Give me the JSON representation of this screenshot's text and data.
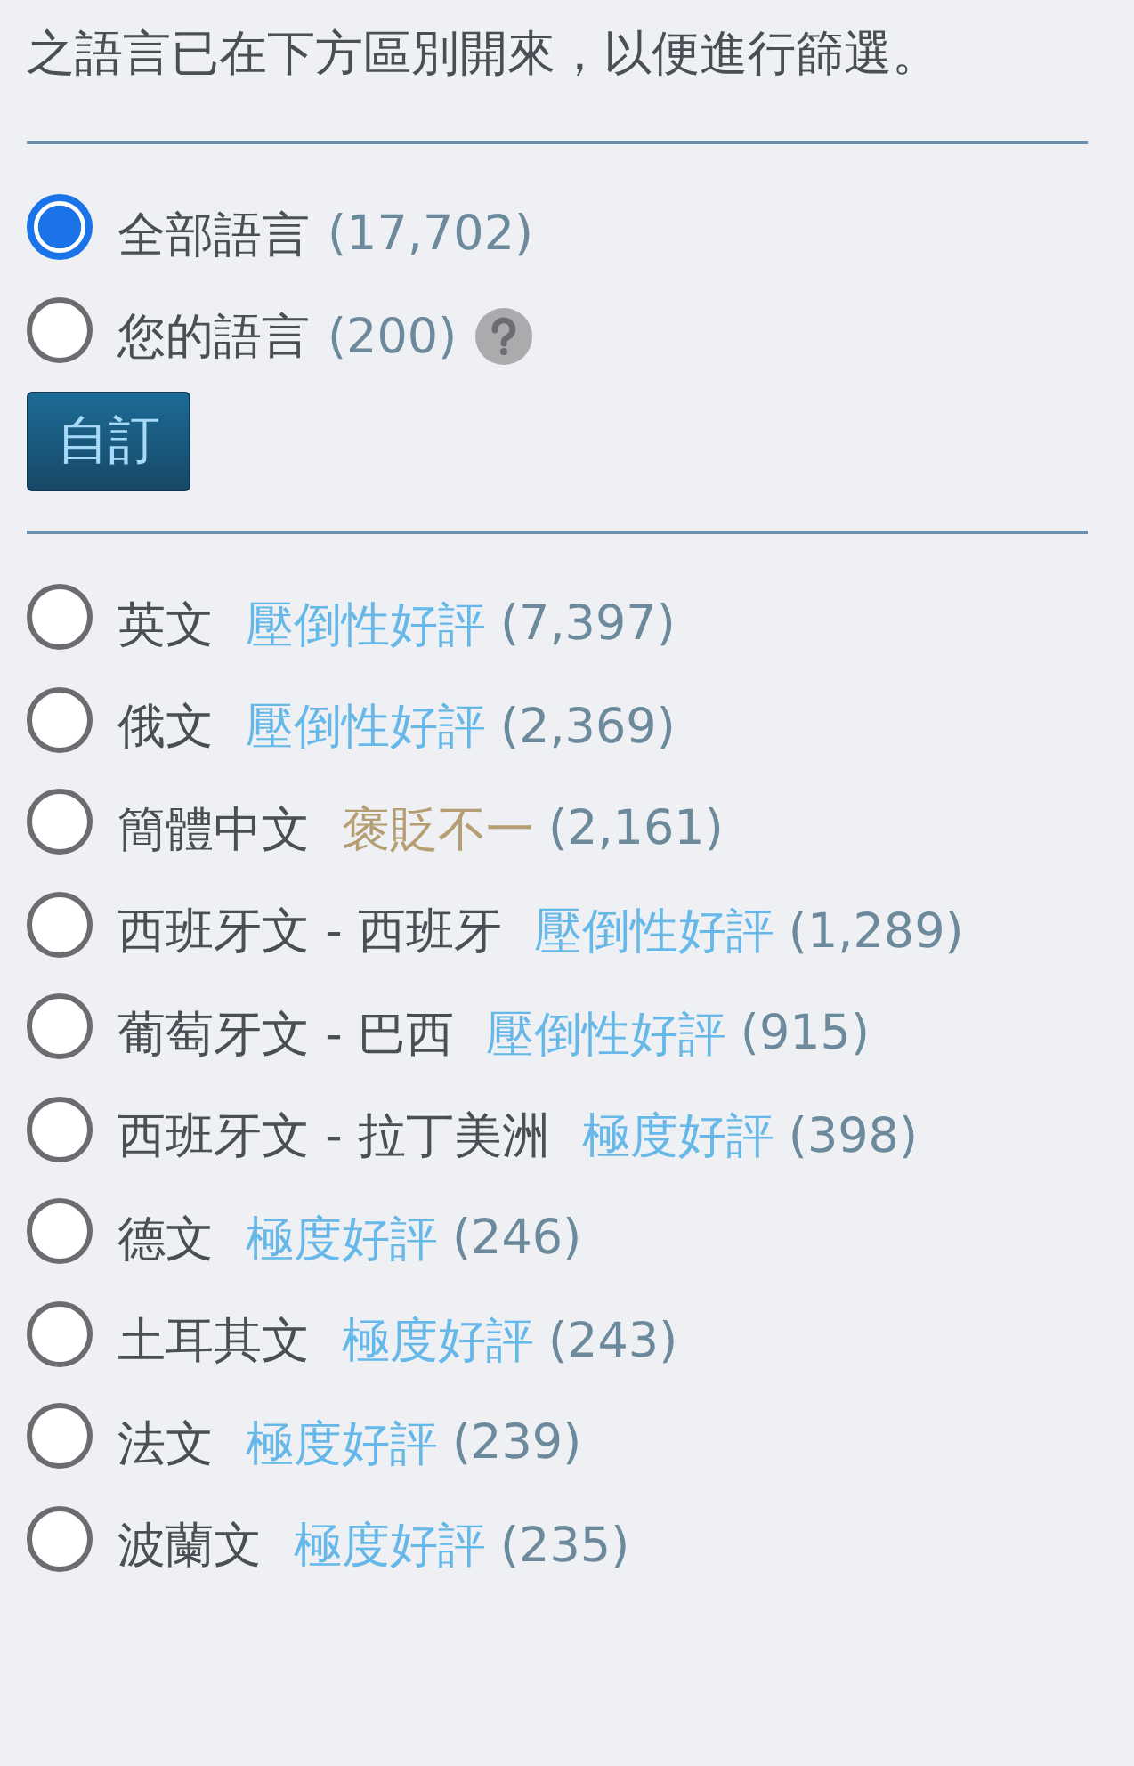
{
  "intro": "之語言已在下方區別開來，以便進行篩選。",
  "scope_options": [
    {
      "label": "全部語言",
      "count": "(17,702)",
      "selected": true,
      "help": false
    },
    {
      "label": "您的語言",
      "count": "(200)",
      "selected": false,
      "help": true
    }
  ],
  "customize_button": "自訂",
  "languages": [
    {
      "label": "英文",
      "rating": "壓倒性好評",
      "color": "#66b8e8",
      "count": "(7,397)",
      "selected": false
    },
    {
      "label": "俄文",
      "rating": "壓倒性好評",
      "color": "#66b8e8",
      "count": "(2,369)",
      "selected": false
    },
    {
      "label": "簡體中文",
      "rating": "褒貶不一",
      "color": "#b49e72",
      "count": "(2,161)",
      "selected": false
    },
    {
      "label": "西班牙文 - 西班牙",
      "rating": "壓倒性好評",
      "color": "#66b8e8",
      "count": "(1,289)",
      "selected": false
    },
    {
      "label": "葡萄牙文 - 巴西",
      "rating": "壓倒性好評",
      "color": "#66b8e8",
      "count": "(915)",
      "selected": false
    },
    {
      "label": "西班牙文 - 拉丁美洲",
      "rating": "極度好評",
      "color": "#66b8e8",
      "count": "(398)",
      "selected": false
    },
    {
      "label": "德文",
      "rating": "極度好評",
      "color": "#66b8e8",
      "count": "(246)",
      "selected": false
    },
    {
      "label": "土耳其文",
      "rating": "極度好評",
      "color": "#66b8e8",
      "count": "(243)",
      "selected": false
    },
    {
      "label": "法文",
      "rating": "極度好評",
      "color": "#66b8e8",
      "count": "(239)",
      "selected": false
    },
    {
      "label": "波蘭文",
      "rating": "極度好評",
      "color": "#66b8e8",
      "count": "(235)",
      "selected": false
    }
  ]
}
